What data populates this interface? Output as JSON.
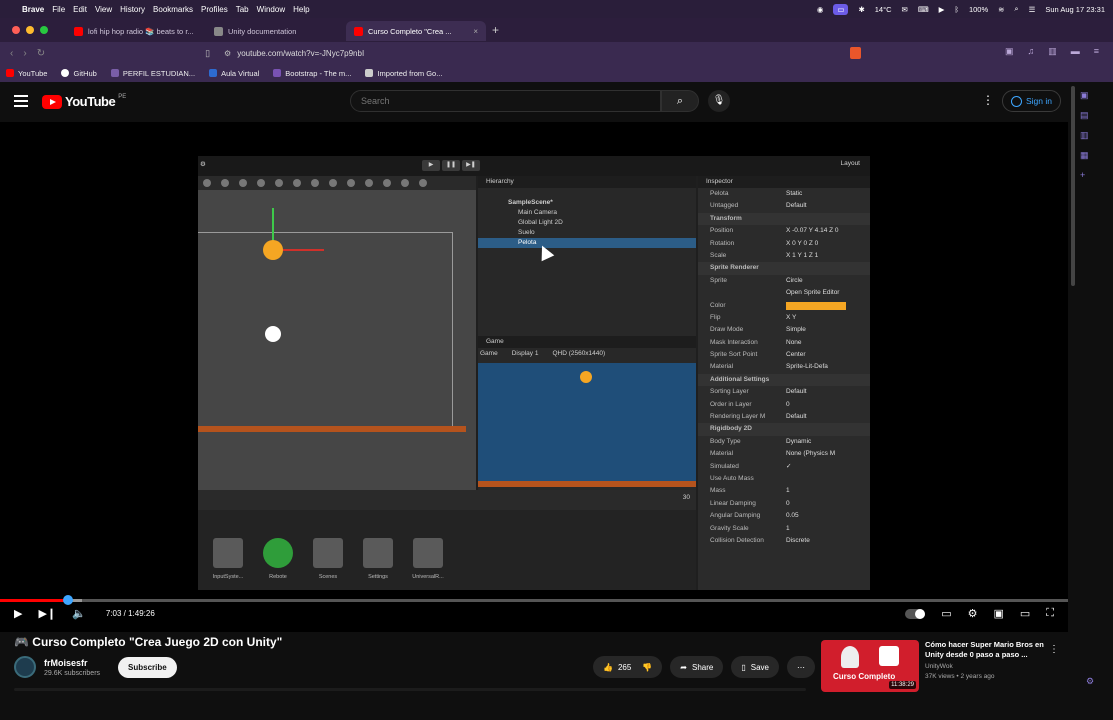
{
  "menubar": {
    "app": "Brave",
    "items": [
      "File",
      "Edit",
      "View",
      "History",
      "Bookmarks",
      "Profiles",
      "Tab",
      "Window",
      "Help"
    ],
    "temperature": "14°C",
    "battery": "100%",
    "datetime": "Sun Aug 17  23:31"
  },
  "tabs": [
    {
      "title": "lofi hip hop radio 📚 beats to r...",
      "favicon_color": "#ff0000",
      "active": false
    },
    {
      "title": "Unity documentation",
      "favicon_color": "#888888",
      "active": false
    },
    {
      "title": "Curso Completo \"Crea ...",
      "favicon_color": "#ff0000",
      "active": true
    }
  ],
  "address": {
    "url": "youtube.com/watch?v=-JNyc7p9nbI"
  },
  "bookmarks": [
    {
      "label": "YouTube",
      "color": "#ff0000"
    },
    {
      "label": "GitHub",
      "color": "#ffffff"
    },
    {
      "label": "PERFIL ESTUDIAN...",
      "color": "#7a5ea8"
    },
    {
      "label": "Aula Virtual",
      "color": "#2d6bd1"
    },
    {
      "label": "Bootstrap - The m...",
      "color": "#7952b3"
    },
    {
      "label": "Imported from Go...",
      "color": "#cccccc"
    }
  ],
  "youtube": {
    "logo_text": "YouTube",
    "country_code": "PE",
    "search_placeholder": "Search",
    "signin_label": "Sign in"
  },
  "unity": {
    "layout_label": "Layout",
    "hierarchy": {
      "title": "Hierarchy",
      "scene": "SampleScene*",
      "items": [
        "Main Camera",
        "Global Light 2D",
        "Suelo",
        "Pelota"
      ],
      "selected": "Pelota"
    },
    "game": {
      "title": "Game",
      "mode": "Game",
      "display": "Display 1",
      "resolution": "QHD (2560x1440)"
    },
    "project_folders": [
      "InputSyste...",
      "Rebote",
      "Scenes",
      "Settings",
      "UniversalR..."
    ],
    "project_count": "30",
    "inspector": {
      "title": "Inspector",
      "object_name": "Pelota",
      "static_label": "Static",
      "tag": "Untagged",
      "layer": "Default",
      "rows": [
        {
          "k": "Transform",
          "v": "",
          "section": true
        },
        {
          "k": "Position",
          "v": "X -0.07   Y 4.14   Z 0",
          "section": false
        },
        {
          "k": "Rotation",
          "v": "X 0   Y 0   Z 0",
          "section": false
        },
        {
          "k": "Scale",
          "v": "X 1   Y 1   Z 1",
          "section": false
        },
        {
          "k": "Sprite Renderer",
          "v": "",
          "section": true
        },
        {
          "k": "Sprite",
          "v": "Circle",
          "section": false
        },
        {
          "k": "",
          "v": "Open Sprite Editor",
          "section": false
        },
        {
          "k": "Color",
          "v": "",
          "section": false,
          "color": "#f5a623"
        },
        {
          "k": "Flip",
          "v": "X   Y",
          "section": false
        },
        {
          "k": "Draw Mode",
          "v": "Simple",
          "section": false
        },
        {
          "k": "Mask Interaction",
          "v": "None",
          "section": false
        },
        {
          "k": "Sprite Sort Point",
          "v": "Center",
          "section": false
        },
        {
          "k": "Material",
          "v": "Sprite-Lit-Defa",
          "section": false
        },
        {
          "k": "Additional Settings",
          "v": "",
          "section": true
        },
        {
          "k": "Sorting Layer",
          "v": "Default",
          "section": false
        },
        {
          "k": "Order in Layer",
          "v": "0",
          "section": false
        },
        {
          "k": "Rendering Layer M",
          "v": "Default",
          "section": false
        },
        {
          "k": "Rigidbody 2D",
          "v": "",
          "section": true
        },
        {
          "k": "Body Type",
          "v": "Dynamic",
          "section": false
        },
        {
          "k": "Material",
          "v": "None (Physics M",
          "section": false
        },
        {
          "k": "Simulated",
          "v": "✓",
          "section": false
        },
        {
          "k": "Use Auto Mass",
          "v": "",
          "section": false
        },
        {
          "k": "Mass",
          "v": "1",
          "section": false
        },
        {
          "k": "Linear Damping",
          "v": "0",
          "section": false
        },
        {
          "k": "Angular Damping",
          "v": "0.05",
          "section": false
        },
        {
          "k": "Gravity Scale",
          "v": "1",
          "section": false
        },
        {
          "k": "Collision Detection",
          "v": "Discrete",
          "section": false
        }
      ]
    }
  },
  "player": {
    "time": "7:03 / 1:49:26",
    "progress_fraction": 0.064
  },
  "video": {
    "title": "🎮 Curso Completo \"Crea Juego 2D con Unity\"",
    "channel": "frMoisesfr",
    "subscribers": "29.6K subscribers",
    "subscribe_label": "Subscribe",
    "likes": "265",
    "share_label": "Share",
    "save_label": "Save"
  },
  "recommended": {
    "title": "Cómo hacer Super Mario Bros en Unity desde 0 paso a paso ...",
    "channel": "UnityWok",
    "meta": "37K views • 2 years ago",
    "duration": "11:38:29",
    "thumb_text": "Curso Completo"
  }
}
